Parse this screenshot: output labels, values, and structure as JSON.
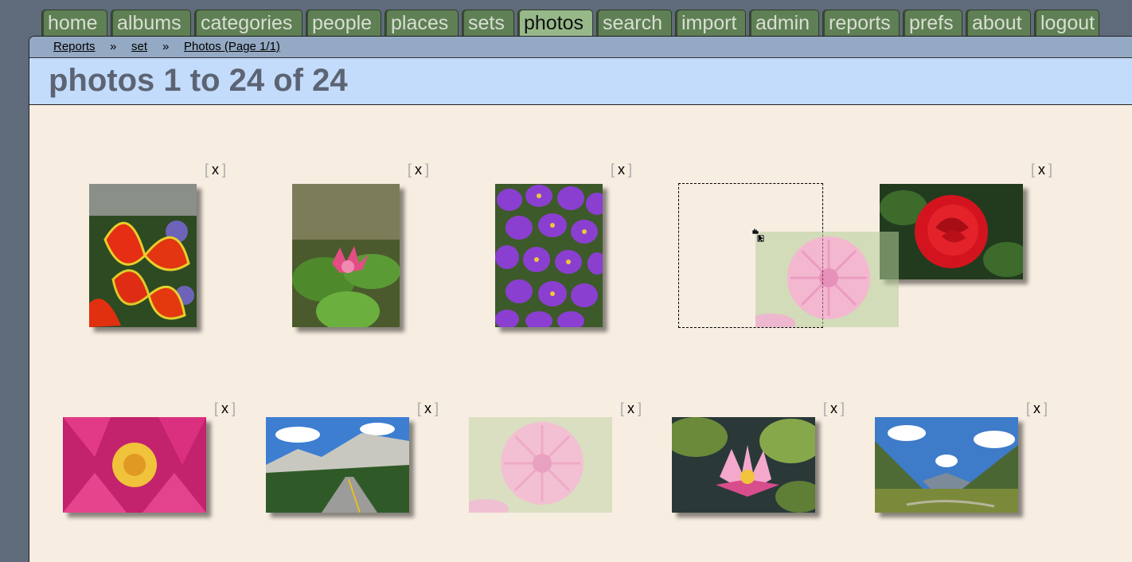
{
  "nav": {
    "tabs": [
      {
        "label": "home"
      },
      {
        "label": "albums"
      },
      {
        "label": "categories"
      },
      {
        "label": "people"
      },
      {
        "label": "places"
      },
      {
        "label": "sets"
      },
      {
        "label": "photos"
      },
      {
        "label": "search"
      },
      {
        "label": "import"
      },
      {
        "label": "admin"
      },
      {
        "label": "reports"
      },
      {
        "label": "prefs"
      },
      {
        "label": "about"
      },
      {
        "label": "logout"
      }
    ],
    "active": "photos"
  },
  "breadcrumb": {
    "items": [
      "Reports",
      "set",
      "Photos (Page 1/1)"
    ],
    "separator": "»"
  },
  "page": {
    "title": "photos 1 to 24 of 24"
  },
  "photos": {
    "remove_label": "x",
    "bracket_open": "[",
    "bracket_close": "]",
    "items": [
      {
        "subject": "red-yellow-lily"
      },
      {
        "subject": "pink-water-lily-pond"
      },
      {
        "subject": "purple-crocus"
      },
      {
        "subject": "pink-dahlia-dragging"
      },
      {
        "subject": "red-rose"
      },
      {
        "subject": "pink-water-lily-closeup"
      },
      {
        "subject": "mountain-road"
      },
      {
        "subject": "pink-dahlia-faded"
      },
      {
        "subject": "pink-water-lily-pads"
      },
      {
        "subject": "mountain-valley"
      }
    ]
  },
  "colors": {
    "tab": "#5f7f55",
    "tab_active": "#97b98a",
    "crumbbar": "#94a9c3",
    "titlebar": "#c4dcfb",
    "content": "#f7ede1"
  }
}
